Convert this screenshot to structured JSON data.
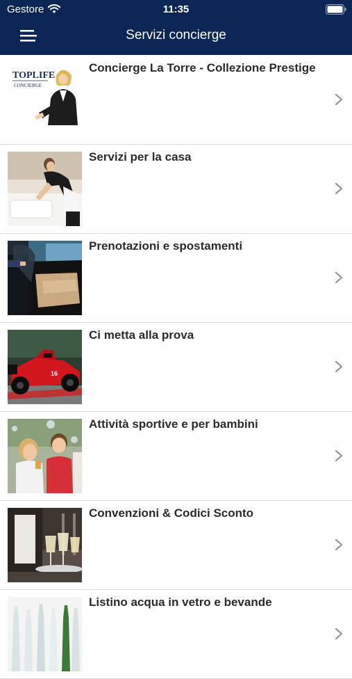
{
  "status_bar": {
    "carrier": "Gestore",
    "time": "11:35"
  },
  "nav": {
    "title": "Servizi concierge"
  },
  "items": [
    {
      "title": "Concierge La Torre - Collezione Prestige",
      "logo_line1": "TOPLIFE",
      "logo_line2": "CONCIERGE"
    },
    {
      "title": "Servizi per la casa"
    },
    {
      "title": "Prenotazioni e spostamenti"
    },
    {
      "title": "Ci metta alla prova"
    },
    {
      "title": "Attività sportive e per bambini"
    },
    {
      "title": "Convenzioni & Codici Sconto"
    },
    {
      "title": "Listino acqua in vetro e bevande"
    }
  ],
  "colors": {
    "navbar": "#0b2555",
    "separator": "#dcdcdc",
    "chevron": "#9a9a9a"
  }
}
